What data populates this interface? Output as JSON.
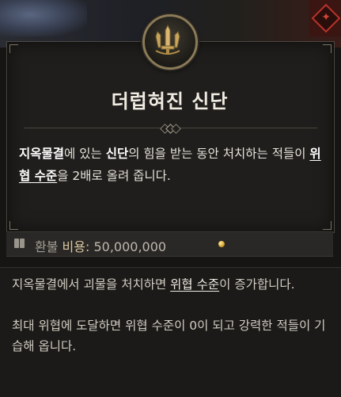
{
  "background": {
    "scene": "game-world",
    "corner_icon": "dungeon-marker-icon"
  },
  "tooltip": {
    "emblem_icon": "sword-shrine-icon",
    "title": "더럽혀진 신단",
    "description": {
      "p1": "지옥물결",
      "p2": "에 있는 ",
      "p3": "신단",
      "p4": "의 힘을 받는 동안 처치하는 적들이 ",
      "p5": "위협 수준",
      "p6": "을 2배로 올려 줍니다."
    },
    "cost": {
      "icon": "refund-book-icon",
      "refund_label": "환불",
      "cost_label": "비용:",
      "amount": "50,000,000",
      "currency_icon": "gold-coin-icon"
    }
  },
  "subtooltip": {
    "line1_a": "지옥물결에서 괴물을 처치하면 ",
    "line1_link": "위협 수준",
    "line1_b": "이 증가합니다.",
    "line2": "최대 위협에 도달하면 위협 수준이 0이 되고 강력한 적들이 기습해 옵니다."
  },
  "colors": {
    "gold": "#d4a02a",
    "accent_red": "#b8342a",
    "title": "#f1ece2"
  }
}
